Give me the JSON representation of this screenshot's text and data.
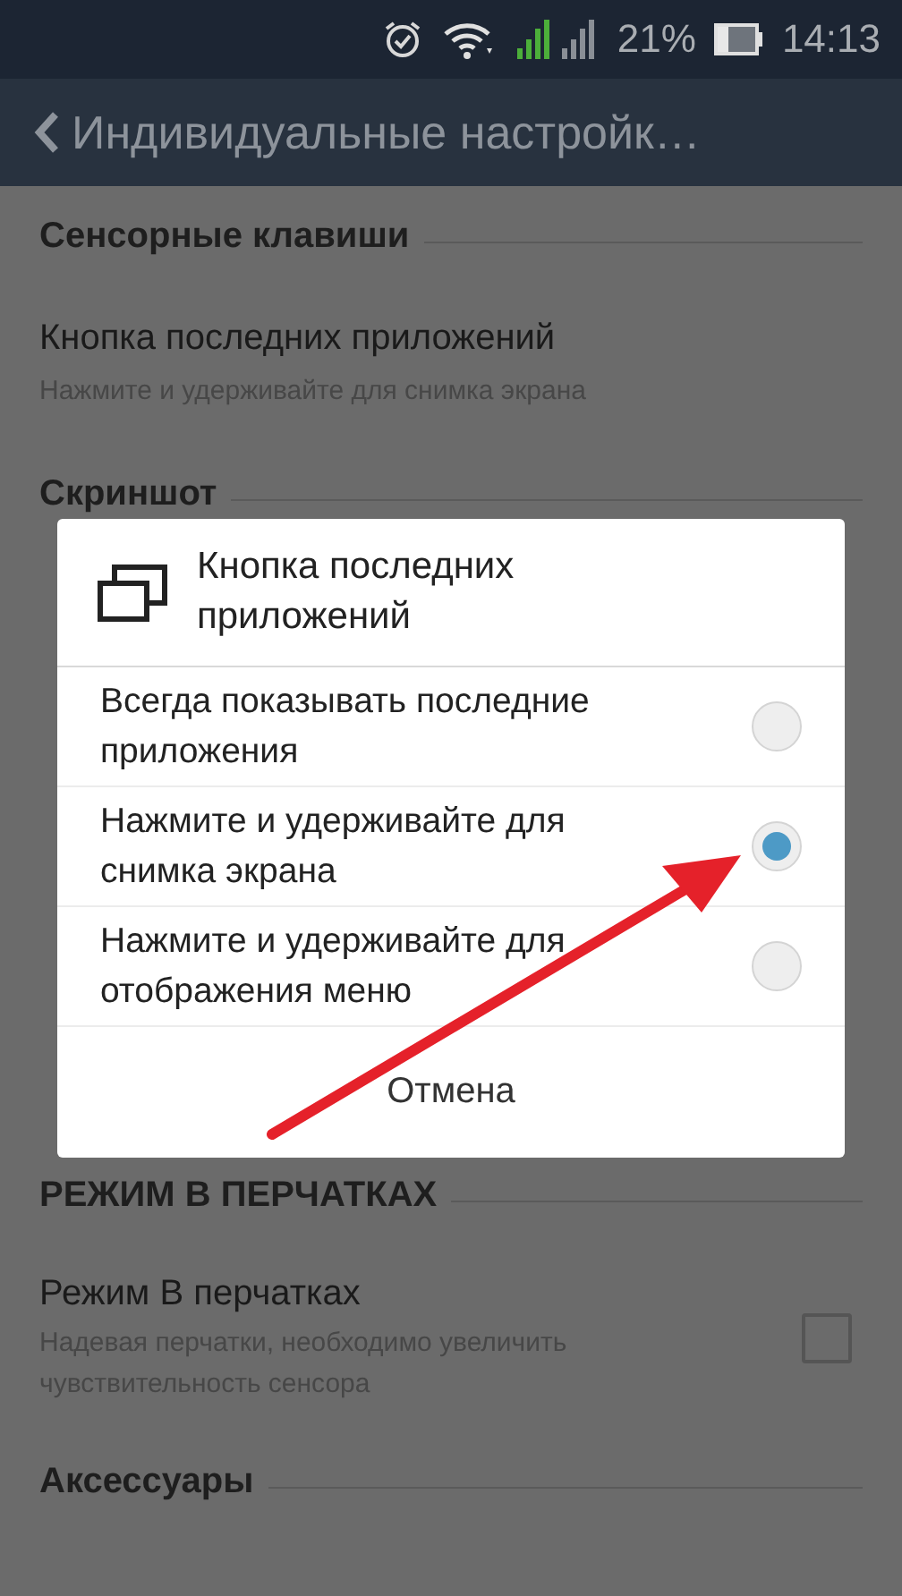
{
  "status_bar": {
    "battery": "21%",
    "time": "14:13"
  },
  "app_bar": {
    "title": "Индивидуальные настройк…"
  },
  "list": [
    {
      "kind": "section",
      "title": "Сенсорные клавиши"
    },
    {
      "kind": "item",
      "title": "Кнопка последних приложений",
      "subtitle": "Нажмите и удерживайте для снимка экрана"
    },
    {
      "kind": "section",
      "title": "Скриншот"
    }
  ],
  "list_below": [
    {
      "kind": "section",
      "title": "РЕЖИМ В ПЕРЧАТКАХ"
    },
    {
      "kind": "toggle",
      "title": "Режим В перчатках",
      "subtitle": "Надевая перчатки, необходимо увеличить чувствительность сенсора",
      "checked": false
    },
    {
      "kind": "section",
      "title": "Аксессуары"
    }
  ],
  "dialog": {
    "title": "Кнопка последних приложений",
    "options": [
      {
        "label": "Всегда показывать последние приложения",
        "selected": false
      },
      {
        "label": "Нажмите и удерживайте для снимка экрана",
        "selected": true
      },
      {
        "label": "Нажмите и удерживайте для отображения меню",
        "selected": false
      }
    ],
    "cancel": "Отмена"
  }
}
